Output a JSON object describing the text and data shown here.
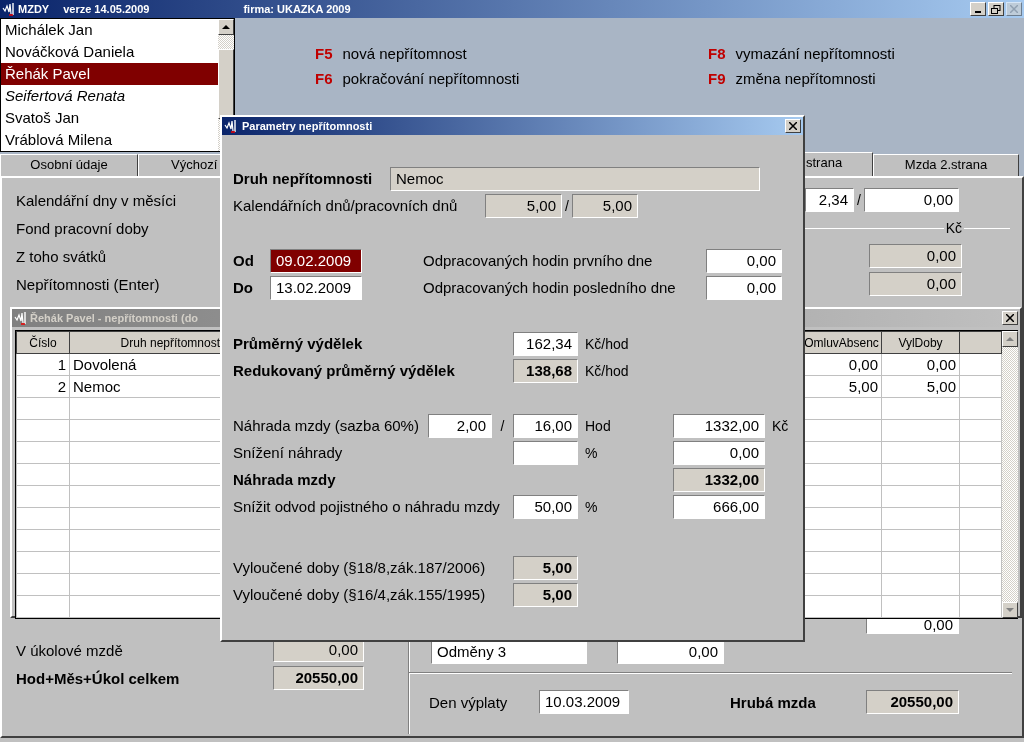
{
  "window": {
    "title": "MZDY",
    "version": "verze 14.05.2009",
    "company": "firma: UKAZKA 2009",
    "close_disabled": true
  },
  "employees": [
    {
      "name": "Michálek Jan",
      "selected": false,
      "italic": false
    },
    {
      "name": "Nováčková Daniela",
      "selected": false,
      "italic": false
    },
    {
      "name": "Řehák Pavel",
      "selected": true,
      "italic": false
    },
    {
      "name": "Seifertová Renata",
      "selected": false,
      "italic": true
    },
    {
      "name": "Svatoš Jan",
      "selected": false,
      "italic": false
    },
    {
      "name": "Vráblová Milena",
      "selected": false,
      "italic": false
    }
  ],
  "shortcuts": [
    {
      "key": "F5",
      "label": "nová nepřítomnost"
    },
    {
      "key": "F8",
      "label": "vymazání nepřítomnosti"
    },
    {
      "key": "F6",
      "label": "pokračování nepřítomnosti"
    },
    {
      "key": "F9",
      "label": "změna nepřítomnosti"
    }
  ],
  "tabs": [
    {
      "label": "Osobní údaje",
      "selected": false
    },
    {
      "label": "Výchozí",
      "selected": false
    },
    {
      "label": "strana",
      "selected": true
    },
    {
      "label": "Mzda 2.strana",
      "selected": false
    }
  ],
  "panel_rows": [
    {
      "kind": "pair",
      "label": "Kalendářní dny v měsíci",
      "values": [
        "2,34",
        "0,00"
      ],
      "separator": "/"
    },
    {
      "kind": "heading",
      "label": "Fond pracovní doby",
      "heading": "Kč"
    },
    {
      "kind": "readonly",
      "label": "Z toho svátků",
      "value": "0,00"
    },
    {
      "kind": "readonly",
      "label": "Nepřítomnosti (Enter)",
      "value": "0,00"
    }
  ],
  "bottom_left": [
    {
      "label": "V úkolové mzdě",
      "value": "0,00",
      "bold": false
    },
    {
      "label": "Hod+Měs+Úkol celkem",
      "value": "20550,00",
      "bold": true
    }
  ],
  "bottom_right": {
    "top_value": "0,00",
    "bonus_name": "Odměny 3",
    "bonus_value": "0,00",
    "payday_label": "Den výplaty",
    "payday": "10.03.2009",
    "gross_label": "Hrubá mzda",
    "gross": "20550,00"
  },
  "absences_window": {
    "title": "Řehák Pavel - nepřítomnosti (do",
    "columns": [
      "Číslo",
      "Druh nepřítomnost",
      "OmluvAbsenc",
      "VylDoby"
    ],
    "rows": [
      {
        "number": "1",
        "type": "Dovolená",
        "excused": "0,00",
        "excluded": "0,00"
      },
      {
        "number": "2",
        "type": "Nemoc",
        "excused": "5,00",
        "excluded": "5,00"
      }
    ]
  },
  "dialog": {
    "title": "Parametry nepřítomnosti",
    "type_label": "Druh nepřítomnosti",
    "type_value": "Nemoc",
    "days_label": "Kalendářních dnů/pracovních dnů",
    "calendar_days": "5,00",
    "days_separator": "/",
    "working_days": "5,00",
    "from_label": "Od",
    "from": "09.02.2009",
    "from_focused": true,
    "to_label": "Do",
    "to": "13.02.2009",
    "first_day_label": "Odpracovaných hodin prvního dne",
    "first_day_hours": "0,00",
    "last_day_label": "Odpracovaných hodin posledního dne",
    "last_day_hours": "0,00",
    "average_label": "Průměrný výdělek",
    "average": "162,34",
    "average_unit": "Kč/hod",
    "reduced_label": "Redukovaný průměrný výdělek",
    "reduced": "138,68",
    "reduced_unit": "Kč/hod",
    "compensation_label": "Náhrada mzdy (sazba 60%)",
    "compensation_days": "2,00",
    "compensation_separator": "/",
    "compensation_hours": "16,00",
    "hours_unit": "Hod",
    "compensation_amount": "1332,00",
    "currency": "Kč",
    "reduction_label": "Snížení náhrady",
    "reduction_unit": "%",
    "reduction_amount": "0,00",
    "total_label": "Náhrada mzdy",
    "total": "1332,00",
    "insurance_label": "Snížit odvod pojistného o náhradu mzdy",
    "insurance_percent": "50,00",
    "insurance_unit": "%",
    "insurance_amount": "666,00",
    "excluded": [
      {
        "label": "Vyloučené doby (§18/8,zák.187/2006)",
        "value": "5,00"
      },
      {
        "label": "Vyloučené doby (§16/4,zák.155/1995)",
        "value": "5,00"
      }
    ]
  }
}
